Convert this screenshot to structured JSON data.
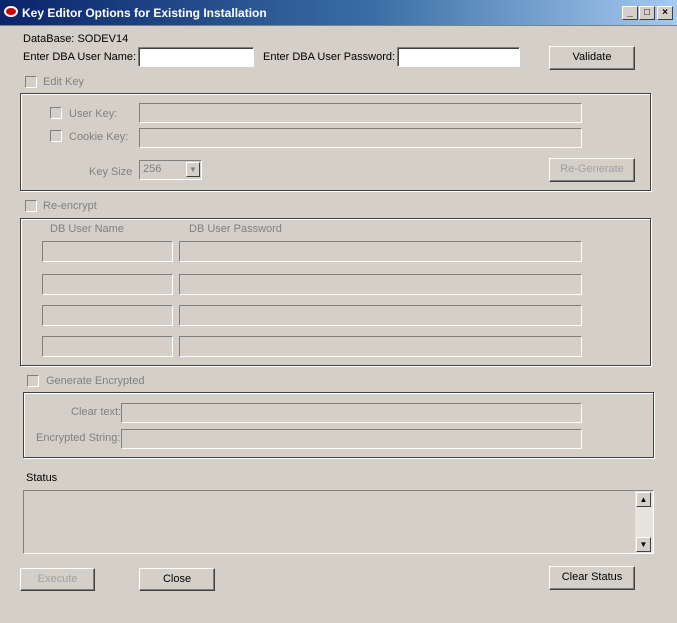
{
  "window": {
    "title": "Key Editor Options for Existing Installation",
    "controls": {
      "minimize": "_",
      "maximize": "□",
      "close": "×"
    }
  },
  "database": {
    "label": "DataBase:",
    "value": "SODEV14"
  },
  "dba": {
    "user_label": "Enter DBA User Name:",
    "user_value": "",
    "password_label": "Enter DBA User Password:",
    "password_value": "",
    "validate_label": "Validate"
  },
  "edit_key": {
    "label": "Edit Key",
    "checked": false,
    "user_key_label": "User Key:",
    "user_key_value": "",
    "cookie_key_label": "Cookie Key:",
    "cookie_key_value": "",
    "key_size_label": "Key Size",
    "key_size_value": "256",
    "regenerate_label": "Re-Generate"
  },
  "reencrypt": {
    "label": "Re-encrypt",
    "checked": false,
    "col_user": "DB User Name",
    "col_password": "DB User Password",
    "rows": [
      {
        "user": "",
        "password": ""
      },
      {
        "user": "",
        "password": ""
      },
      {
        "user": "",
        "password": ""
      },
      {
        "user": "",
        "password": ""
      }
    ]
  },
  "generate": {
    "label": "Generate Encrypted",
    "checked": false,
    "clear_label": "Clear text:",
    "clear_value": "",
    "encrypted_label": "Encrypted String:",
    "encrypted_value": ""
  },
  "status": {
    "label": "Status",
    "text": "",
    "scroll_up": "▲",
    "scroll_down": "▼"
  },
  "buttons": {
    "execute": "Execute",
    "close": "Close",
    "clear_status": "Clear Status"
  }
}
